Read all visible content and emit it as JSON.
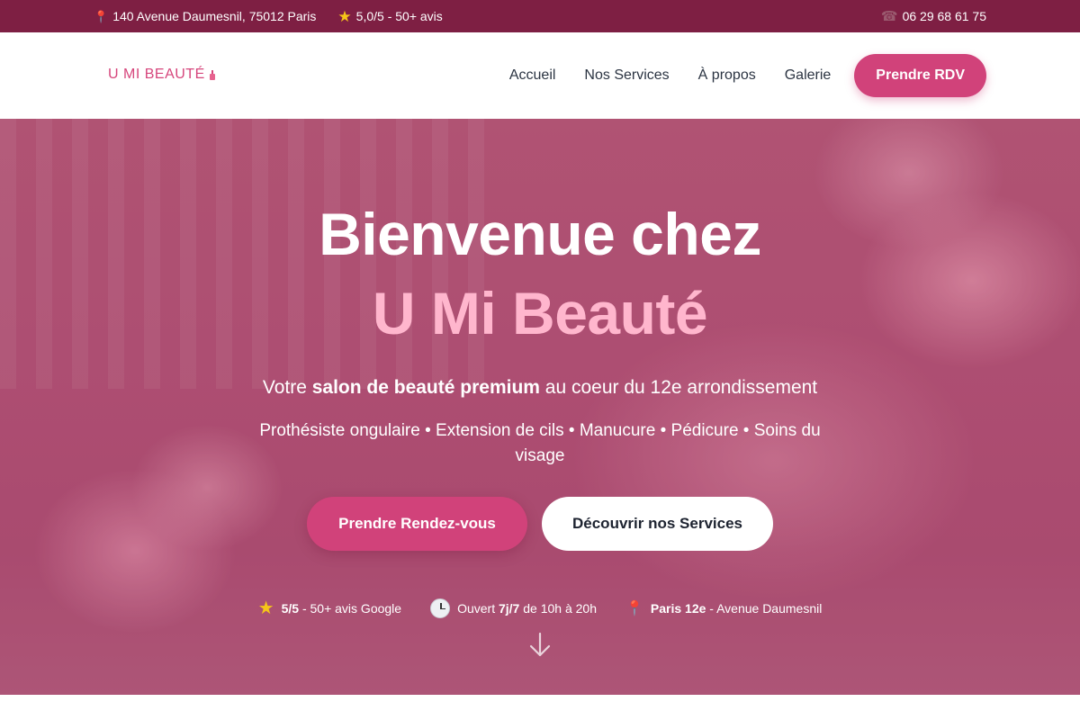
{
  "topbar": {
    "address_icon": "map-pin-icon",
    "address": "140 Avenue Daumesnil, 75012 Paris",
    "rating_icon": "star-icon",
    "rating": "5,0/5 - 50+ avis",
    "phone_icon": "phone-icon",
    "phone": "06 29 68 61 75"
  },
  "navbar": {
    "logo": "U MI BEAUTÉ",
    "logo_icon": "nail-polish-icon",
    "links": [
      "Accueil",
      "Nos Services",
      "À propos",
      "Galerie"
    ],
    "cta": "Prendre RDV"
  },
  "hero": {
    "title_line1": "Bienvenue chez",
    "title_line2": "U Mi Beauté",
    "subtitle_pre": "Votre ",
    "subtitle_bold": "salon de beauté premium",
    "subtitle_post": " au coeur du 12e arrondissement",
    "services": "Prothésiste ongulaire • Extension de cils • Manucure • Pédicure • Soins du visage",
    "primary_button": "Prendre Rendez-vous",
    "secondary_button": "Découvrir nos Services",
    "badges": {
      "rating_bold": "5/5",
      "rating_text": " - 50+ avis Google",
      "hours_pre": "Ouvert ",
      "hours_bold": "7j/7",
      "hours_post": " de 10h à 20h",
      "location_bold": "Paris 12e",
      "location_text": " - Avenue Daumesnil"
    },
    "scroll_icon": "arrow-down-icon"
  },
  "colors": {
    "topbar_bg": "#7e1f43",
    "accent": "#d1427a",
    "title_highlight": "#ffb6cd"
  }
}
